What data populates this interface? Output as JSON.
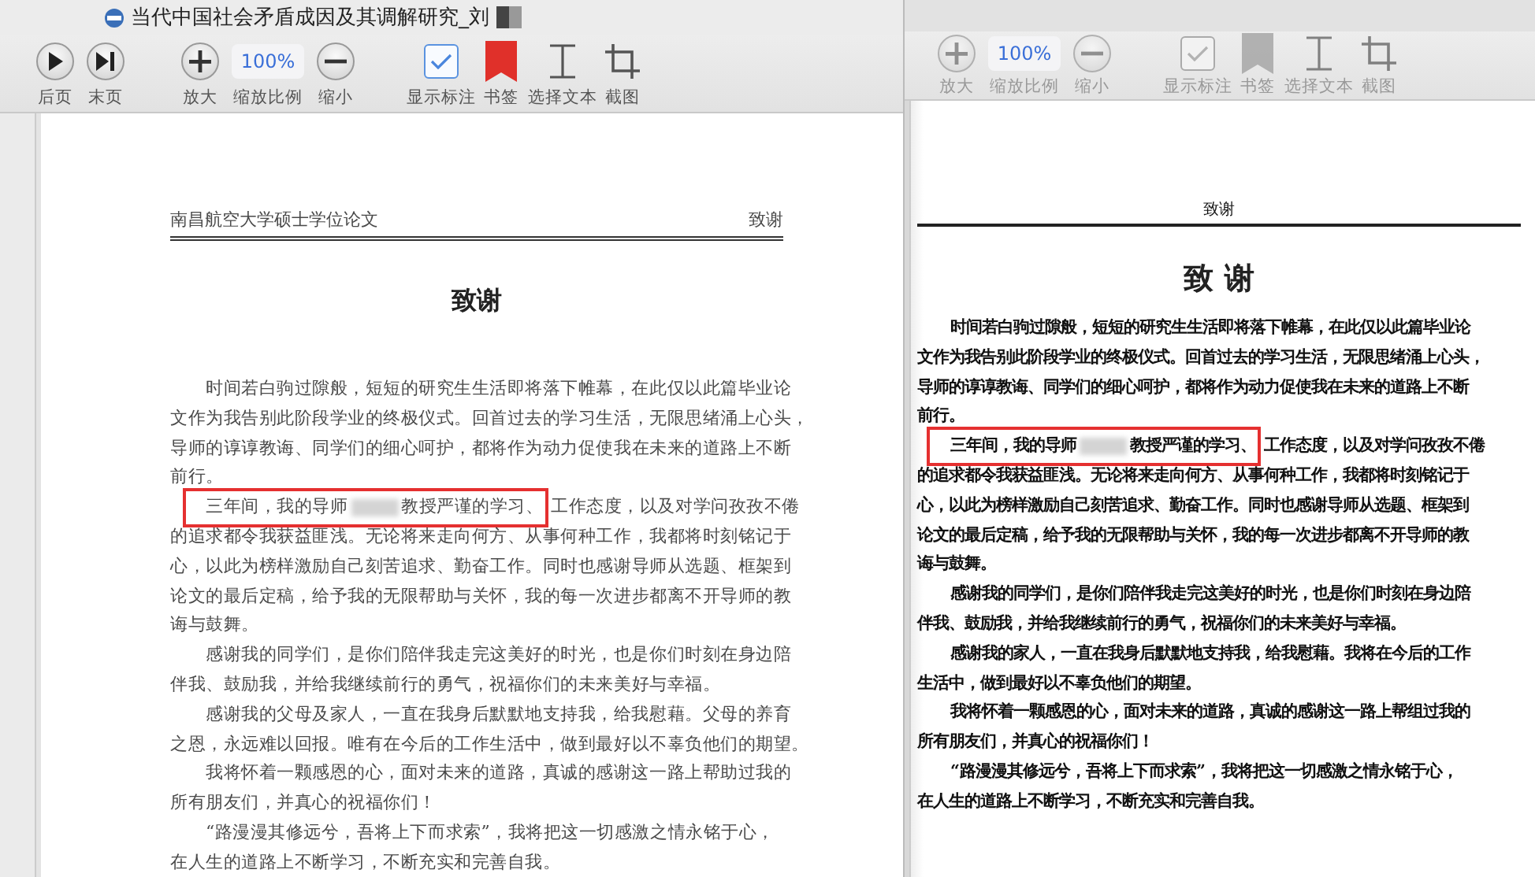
{
  "windows": [
    {
      "active": true,
      "title": "当代中国社会矛盾成因及其调解研究_刘",
      "toolbar": [
        {
          "kind": "prev",
          "label": "后页"
        },
        {
          "kind": "last",
          "label": "末页"
        },
        {
          "kind": "zoom-in",
          "label": "放大"
        },
        {
          "kind": "zoom-field",
          "label": "缩放比例",
          "value": "100%"
        },
        {
          "kind": "zoom-out",
          "label": "缩小"
        },
        {
          "kind": "annotations",
          "label": "显示标注",
          "checked": true
        },
        {
          "kind": "bookmark",
          "label": "书签"
        },
        {
          "kind": "select-text",
          "label": "选择文本"
        },
        {
          "kind": "crop",
          "label": "截图"
        }
      ],
      "page": {
        "header": {
          "left": "南昌航空大学硕士学位论文",
          "right": "致谢"
        },
        "heading": "致谢",
        "paragraphs": [
          {
            "lines": [
              "时间若白驹过隙般，短短的研究生生活即将落下帷幕，在此仅以此篇毕业论",
              "文作为我告别此阶段学业的终极仪式。回首过去的学习生活，无限思绪涌上心头，",
              "导师的谆谆教诲、同学们的细心呵护，都将作为动力促使我在未来的道路上不断",
              "前行。"
            ]
          },
          {
            "highlight": {
              "before": "三年间，我的导师",
              "after": "教授严谨的学习、",
              "rest": "工作态度，以及对学问孜孜不倦"
            },
            "lines": [
              "的追求都令我获益匪浅。无论将来走向何方、从事何种工作，我都将时刻铭记于",
              "心，以此为榜样激励自己刻苦追求、勤奋工作。同时也感谢导师从选题、框架到",
              "论文的最后定稿，给予我的无限帮助与关怀，我的每一次进步都离不开导师的教",
              "诲与鼓舞。"
            ]
          },
          {
            "lines": [
              "感谢我的同学们，是你们陪伴我走完这美好的时光，也是你们时刻在身边陪",
              "伴我、鼓励我，并给我继续前行的勇气，祝福你们的未来美好与幸福。"
            ]
          },
          {
            "lines": [
              "感谢我的父母及家人，一直在我身后默默地支持我，给我慰藉。父母的养育",
              "之恩，永远难以回报。唯有在今后的工作生活中，做到最好以不辜负他们的期望。"
            ]
          },
          {
            "lines": [
              "我将怀着一颗感恩的心，面对未来的道路，真诚的感谢这一路上帮助过我的",
              "所有朋友们，并真心的祝福你们！"
            ]
          },
          {
            "lines": [
              "“路漫漫其修远兮，吾将上下而求索”，我将把这一切感激之情永铭于心，",
              "在人生的道路上不断学习，不断充实和完善自我。"
            ]
          }
        ]
      }
    },
    {
      "active": false,
      "toolbar": [
        {
          "kind": "zoom-in",
          "label": "放大"
        },
        {
          "kind": "zoom-field",
          "label": "缩放比例",
          "value": "100%"
        },
        {
          "kind": "zoom-out",
          "label": "缩小"
        },
        {
          "kind": "annotations",
          "label": "显示标注",
          "checked": true
        },
        {
          "kind": "bookmark",
          "label": "书签"
        },
        {
          "kind": "select-text",
          "label": "选择文本"
        },
        {
          "kind": "crop",
          "label": "截图"
        }
      ],
      "page": {
        "header": {
          "center": "致谢"
        },
        "heading": "致 谢",
        "paragraphs": [
          {
            "lines": [
              "时间若白驹过隙般，短短的研究生生活即将落下帷幕，在此仅以此篇毕业论",
              "文作为我告别此阶段学业的终极仪式。回首过去的学习生活，无限思绪涌上心头，",
              "导师的谆谆教诲、同学们的细心呵护，都将作为动力促使我在未来的道路上不断",
              "前行。"
            ]
          },
          {
            "highlight": {
              "before": "三年间，我的导师",
              "after": "教授严谨的学习、",
              "rest": "工作态度，以及对学问孜孜不倦"
            },
            "lines": [
              "的追求都令我获益匪浅。无论将来走向何方、从事何种工作，我都将时刻铭记于",
              "心，以此为榜样激励自己刻苦追求、勤奋工作。同时也感谢导师从选题、框架到",
              "论文的最后定稿，给予我的无限帮助与关怀，我的每一次进步都离不开导师的教",
              "诲与鼓舞。"
            ]
          },
          {
            "lines": [
              "感谢我的同学们，是你们陪伴我走完这美好的时光，也是你们时刻在身边陪",
              "伴我、鼓励我，并给我继续前行的勇气，祝福你们的未来美好与幸福。"
            ]
          },
          {
            "lines": [
              "感谢我的家人，一直在我身后默默地支持我，给我慰藉。我将在今后的工作",
              "生活中，做到最好以不辜负他们的期望。"
            ]
          },
          {
            "lines": [
              "我将怀着一颗感恩的心，面对未来的道路，真诚的感谢这一路上帮组过我的",
              "所有朋友们，并真心的祝福你们！"
            ]
          },
          {
            "lines": [
              "“路漫漫其修远兮，吾将上下而求索”，我将把这一切感激之情永铭于心，",
              "在人生的道路上不断学习，不断充实和完善自我。"
            ]
          }
        ]
      }
    }
  ]
}
